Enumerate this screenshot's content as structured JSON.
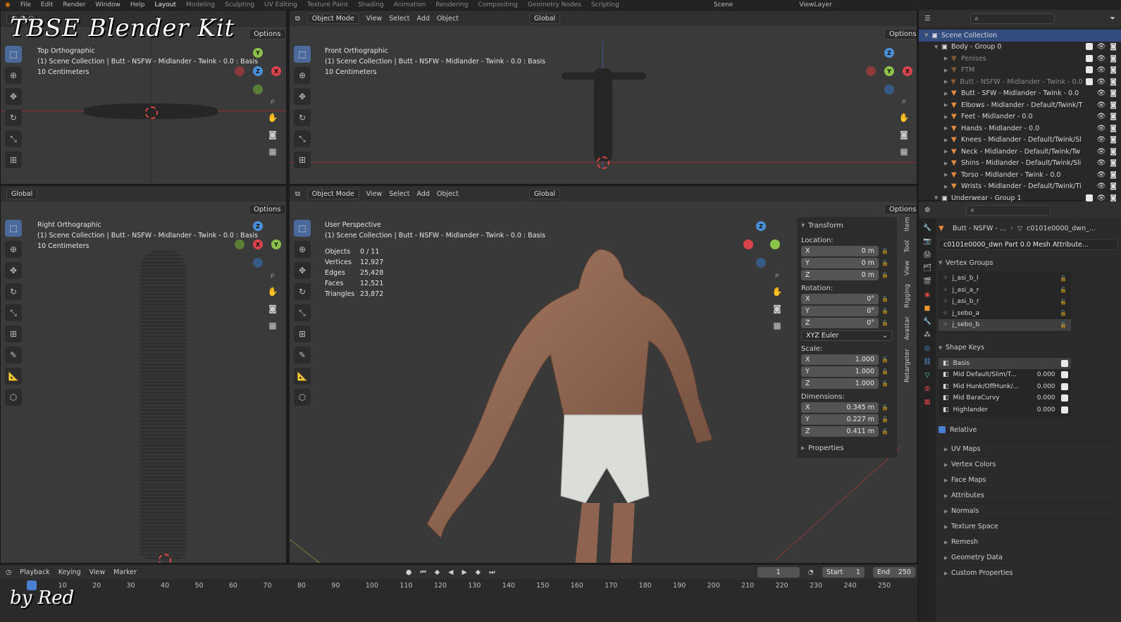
{
  "topbar": {
    "menus": [
      "File",
      "Edit",
      "Render",
      "Window",
      "Help"
    ],
    "workspaces": [
      "Layout",
      "Modeling",
      "Sculpting",
      "UV Editing",
      "Texture Paint",
      "Shading",
      "Animation",
      "Rendering",
      "Compositing",
      "Geometry Nodes",
      "Scripting"
    ],
    "active_workspace": "Layout",
    "scene": "Scene",
    "view_layer": "ViewLayer"
  },
  "watermark": {
    "title": "TBSE Blender Kit",
    "byline": "by Red"
  },
  "viewports": {
    "top": {
      "name": "Top Orthographic",
      "collection": "(1) Scene Collection | Butt - NSFW - Midlander - Twink - 0.0 : Basis",
      "scale": "10 Centimeters",
      "options": "Options"
    },
    "front": {
      "name": "Front Orthographic",
      "collection": "(1) Scene Collection | Butt - NSFW - Midlander - Twink - 0.0 : Basis",
      "scale": "10 Centimeters",
      "mode": "Object Mode",
      "menus": [
        "View",
        "Select",
        "Add",
        "Object"
      ],
      "transform": "Global",
      "options": "Options"
    },
    "right": {
      "name": "Right Orthographic",
      "collection": "(1) Scene Collection | Butt - NSFW - Midlander - Twink - 0.0 : Basis",
      "scale": "10 Centimeters",
      "transform": "Global",
      "options": "Options"
    },
    "persp": {
      "name": "User Perspective",
      "collection": "(1) Scene Collection | Butt - NSFW - Midlander - Twink - 0.0 : Basis",
      "mode": "Object Mode",
      "menus": [
        "View",
        "Select",
        "Add",
        "Object"
      ],
      "transform": "Global",
      "options": "Options",
      "stats": [
        {
          "k": "Objects",
          "v": "0 / 11"
        },
        {
          "k": "Vertices",
          "v": "12,927"
        },
        {
          "k": "Edges",
          "v": "25,428"
        },
        {
          "k": "Faces",
          "v": "12,521"
        },
        {
          "k": "Triangles",
          "v": "23,872"
        }
      ]
    }
  },
  "npanel": {
    "title": "Transform",
    "location_label": "Location:",
    "location": [
      {
        "a": "X",
        "v": "0 m"
      },
      {
        "a": "Y",
        "v": "0 m"
      },
      {
        "a": "Z",
        "v": "0 m"
      }
    ],
    "rotation_label": "Rotation:",
    "rotation": [
      {
        "a": "X",
        "v": "0°"
      },
      {
        "a": "Y",
        "v": "0°"
      },
      {
        "a": "Z",
        "v": "0°"
      }
    ],
    "rotation_mode": "XYZ Euler",
    "scale_label": "Scale:",
    "scale": [
      {
        "a": "X",
        "v": "1.000"
      },
      {
        "a": "Y",
        "v": "1.000"
      },
      {
        "a": "Z",
        "v": "1.000"
      }
    ],
    "dimensions_label": "Dimensions:",
    "dimensions": [
      {
        "a": "X",
        "v": "0.345 m"
      },
      {
        "a": "Y",
        "v": "0.227 m"
      },
      {
        "a": "Z",
        "v": "0.411 m"
      }
    ],
    "properties": "Properties",
    "tabs": [
      "Item",
      "Tool",
      "View",
      "Rigging",
      "Avastar",
      "Retargeter"
    ]
  },
  "outliner": {
    "rows": [
      {
        "name": "Scene Collection",
        "indent": 0,
        "type": "coll"
      },
      {
        "name": "Body - Group 0",
        "indent": 1,
        "type": "coll"
      },
      {
        "name": "Penises",
        "indent": 2,
        "type": "dim"
      },
      {
        "name": "FTM",
        "indent": 2,
        "type": "dim"
      },
      {
        "name": "Butt - NSFW - Midlander - Twink - 0.0",
        "indent": 2,
        "type": "dim"
      },
      {
        "name": "Butt - SFW - Midlander - Twink - 0.0",
        "indent": 2,
        "type": "mesh"
      },
      {
        "name": "Elbows - Midlander - Default/Twink/T",
        "indent": 2,
        "type": "mesh"
      },
      {
        "name": "Feet - Midlander - 0.0",
        "indent": 2,
        "type": "mesh"
      },
      {
        "name": "Hands - Midlander - 0.0",
        "indent": 2,
        "type": "mesh"
      },
      {
        "name": "Knees - Midlander - Default/Twink/Sl",
        "indent": 2,
        "type": "mesh"
      },
      {
        "name": "Neck - Midlander - Default/Twink/Tw",
        "indent": 2,
        "type": "mesh"
      },
      {
        "name": "Shins - Midlander - Default/Twink/Sli",
        "indent": 2,
        "type": "mesh"
      },
      {
        "name": "Torso - Midlander - Twink - 0.0",
        "indent": 2,
        "type": "mesh"
      },
      {
        "name": "Wrists - Midlander - Default/Twink/Ti",
        "indent": 2,
        "type": "mesh"
      },
      {
        "name": "Underwear - Group 1",
        "indent": 1,
        "type": "coll"
      }
    ]
  },
  "properties": {
    "object": "Butt - NSFW - ...",
    "mesh": "c0101e0000_dwn_...",
    "mesh_full": "c0101e0000_dwn Part 0.0 Mesh Attribute...",
    "vertex_groups_title": "Vertex Groups",
    "vertex_groups": [
      "j_asi_b_l",
      "j_asi_a_r",
      "j_asi_b_r",
      "j_sebo_a",
      "j_sebo_b"
    ],
    "shape_keys_title": "Shape Keys",
    "shape_keys": [
      {
        "n": "Basis",
        "v": ""
      },
      {
        "n": "Mid Default/Slim/T...",
        "v": "0.000"
      },
      {
        "n": "Mid Hunk/OffHunk/...",
        "v": "0.000"
      },
      {
        "n": "Mid BaraCurvy",
        "v": "0.000"
      },
      {
        "n": "Highlander",
        "v": "0.000"
      }
    ],
    "relative": "Relative",
    "sections": [
      "UV Maps",
      "Vertex Colors",
      "Face Maps",
      "Attributes",
      "Normals",
      "Texture Space",
      "Remesh",
      "Geometry Data",
      "Custom Properties"
    ]
  },
  "timeline": {
    "menus": [
      "Playback",
      "Keying",
      "View",
      "Marker"
    ],
    "current": "1",
    "start_label": "Start",
    "start": "1",
    "end_label": "End",
    "end": "250",
    "ticks": [
      "1",
      "10",
      "20",
      "30",
      "40",
      "50",
      "60",
      "70",
      "80",
      "90",
      "100",
      "110",
      "120",
      "130",
      "140",
      "150",
      "160",
      "170",
      "180",
      "190",
      "200",
      "210",
      "220",
      "230",
      "240",
      "250"
    ]
  }
}
